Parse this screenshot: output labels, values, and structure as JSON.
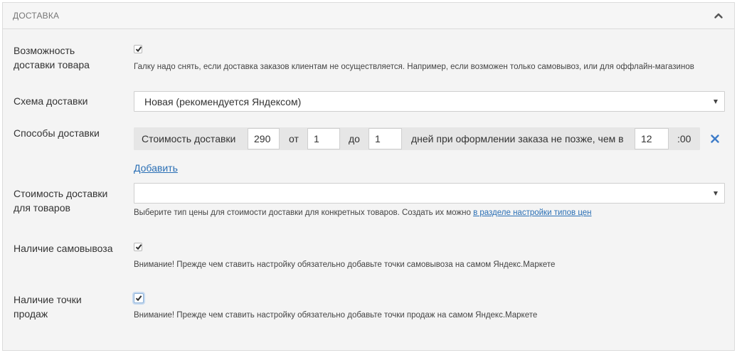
{
  "panel": {
    "title": "ДОСТАВКА"
  },
  "fields": {
    "delivery_possible": {
      "label_line1": "Возможность",
      "label_line2": "доставки товара",
      "checked": true,
      "hint": "Галку надо снять, если доставка заказов клиентам не осуществляется. Например, если возможен только самовывоз, или для оффлайн-магазинов"
    },
    "delivery_scheme": {
      "label": "Схема доставки",
      "selected": "Новая (рекомендуется Яндексом)"
    },
    "delivery_methods": {
      "label": "Способы доставки",
      "cost_label": "Стоимость доставки",
      "cost_value": "290",
      "from_label": "от",
      "from_value": "1",
      "to_label": "до",
      "to_value": "1",
      "days_label": "дней при оформлении заказа не позже, чем в",
      "hour_value": "12",
      "minutes_suffix": ":00",
      "add_link": "Добавить"
    },
    "goods_delivery_cost": {
      "label_line1": "Стоимость доставки",
      "label_line2": "для товаров",
      "selected": "",
      "hint_text": "Выберите тип цены для стоимости доставки для конкретных товаров. Создать их можно ",
      "hint_link": "в разделе настройки типов цен"
    },
    "pickup": {
      "label": "Наличие самовывоза",
      "checked": true,
      "hint": "Внимание! Прежде чем ставить настройку обязательно добавьте точки самовывоза на самом Яндекс.Маркете"
    },
    "sale_points": {
      "label_line1": "Наличие точки",
      "label_line2": "продаж",
      "checked": true,
      "hint": "Внимание! Прежде чем ставить настройку обязательно добавьте точки продаж на самом Яндекс.Маркете"
    }
  },
  "icons": {
    "collapse": "chevron-up-icon",
    "remove": "close-icon",
    "dropdown": "caret-down-icon"
  },
  "colors": {
    "link": "#2a6fb5",
    "remove_icon": "#3d7cc9",
    "panel_bg": "#f4f4f4",
    "method_row_bg": "#e6e6e6"
  }
}
